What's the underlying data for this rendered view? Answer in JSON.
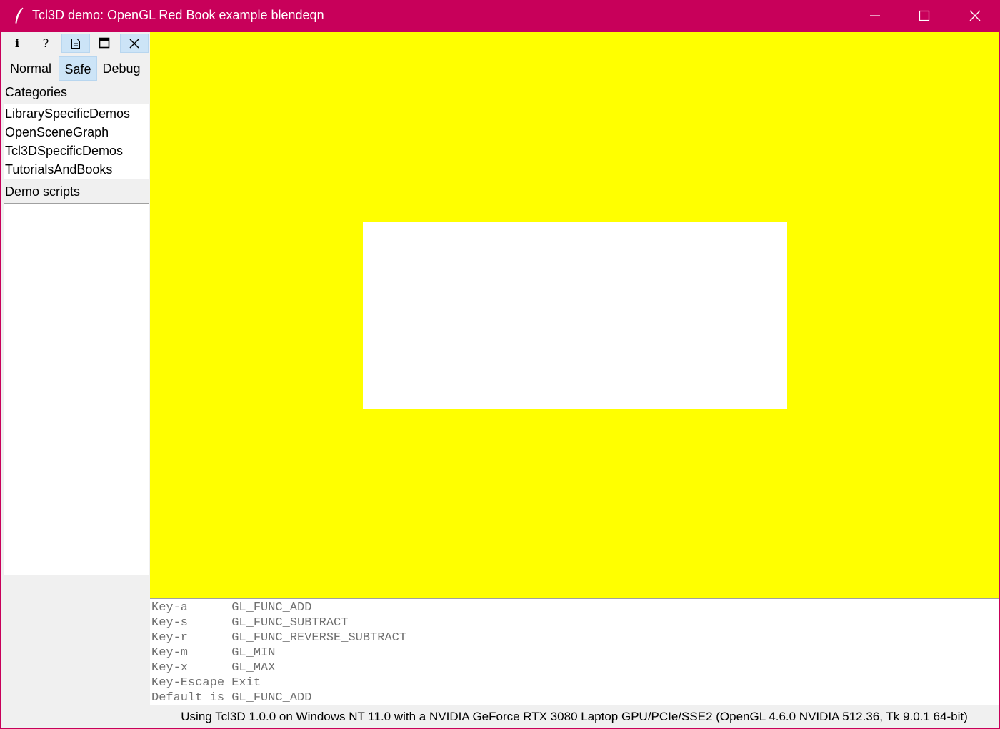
{
  "window": {
    "title": "Tcl3D demo: OpenGL Red Book example blendeqn",
    "accent_color": "#c8005a",
    "app_icon": "feather-icon"
  },
  "toolbar": {
    "info_label": "i",
    "help_label": "?",
    "buttons": [
      "info-icon",
      "help-icon",
      "document-icon",
      "window-icon",
      "close-icon"
    ]
  },
  "modes": {
    "normal": "Normal",
    "safe": "Safe",
    "debug": "Debug",
    "selected": "Safe"
  },
  "categories": {
    "label": "Categories",
    "items": [
      "LibrarySpecificDemos",
      "OpenSceneGraph",
      "Tcl3DSpecificDemos",
      "TutorialsAndBooks"
    ]
  },
  "scripts": {
    "label": "Demo scripts",
    "items": []
  },
  "canvas": {
    "background_color": "#ffff00",
    "rect_color": "#ffffff"
  },
  "info": {
    "lines": [
      "Key-a      GL_FUNC_ADD",
      "Key-s      GL_FUNC_SUBTRACT",
      "Key-r      GL_FUNC_REVERSE_SUBTRACT",
      "Key-m      GL_MIN",
      "Key-x      GL_MAX",
      "Key-Escape Exit",
      "Default is GL_FUNC_ADD"
    ]
  },
  "status": {
    "text": "Using Tcl3D 1.0.0 on Windows NT 11.0 with a NVIDIA GeForce RTX 3080 Laptop GPU/PCIe/SSE2 (OpenGL 4.6.0 NVIDIA 512.36, Tk 9.0.1 64-bit)"
  }
}
